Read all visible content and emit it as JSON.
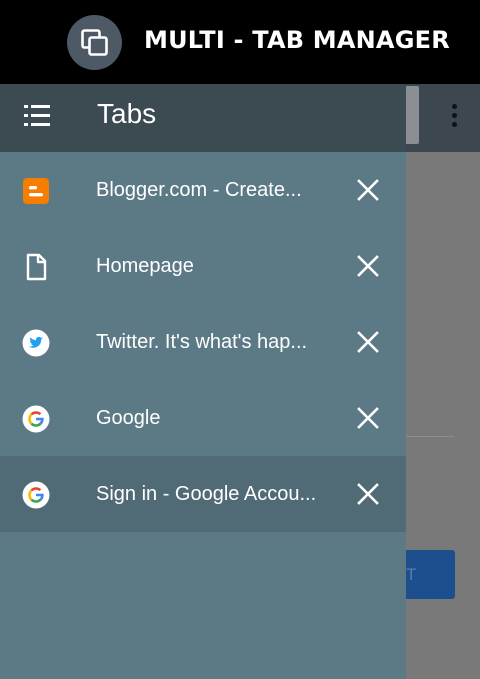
{
  "banner": {
    "title": "MULTI - TAB MANAGER",
    "logo_icon": "overlapping-squares-icon"
  },
  "background": {
    "button_text": "T"
  },
  "drawer": {
    "menu_icon": "list-icon",
    "title": "Tabs",
    "tabs": [
      {
        "icon": "blogger-icon",
        "title": "Blogger.com - Create...",
        "close_icon": "close-icon"
      },
      {
        "icon": "document-icon",
        "title": "Homepage",
        "close_icon": "close-icon"
      },
      {
        "icon": "twitter-icon",
        "title": "Twitter. It's what's hap...",
        "close_icon": "close-icon"
      },
      {
        "icon": "google-icon",
        "title": "Google",
        "close_icon": "close-icon"
      },
      {
        "icon": "google-icon",
        "title": "Sign in - Google Accou...",
        "close_icon": "close-icon",
        "active": true
      }
    ]
  },
  "colors": {
    "drawer_bg": "#5c7a85",
    "drawer_header": "#3c4a52",
    "active_row": "#506b76",
    "blogger_orange": "#f57d00",
    "twitter_blue": "#1da1f2"
  }
}
